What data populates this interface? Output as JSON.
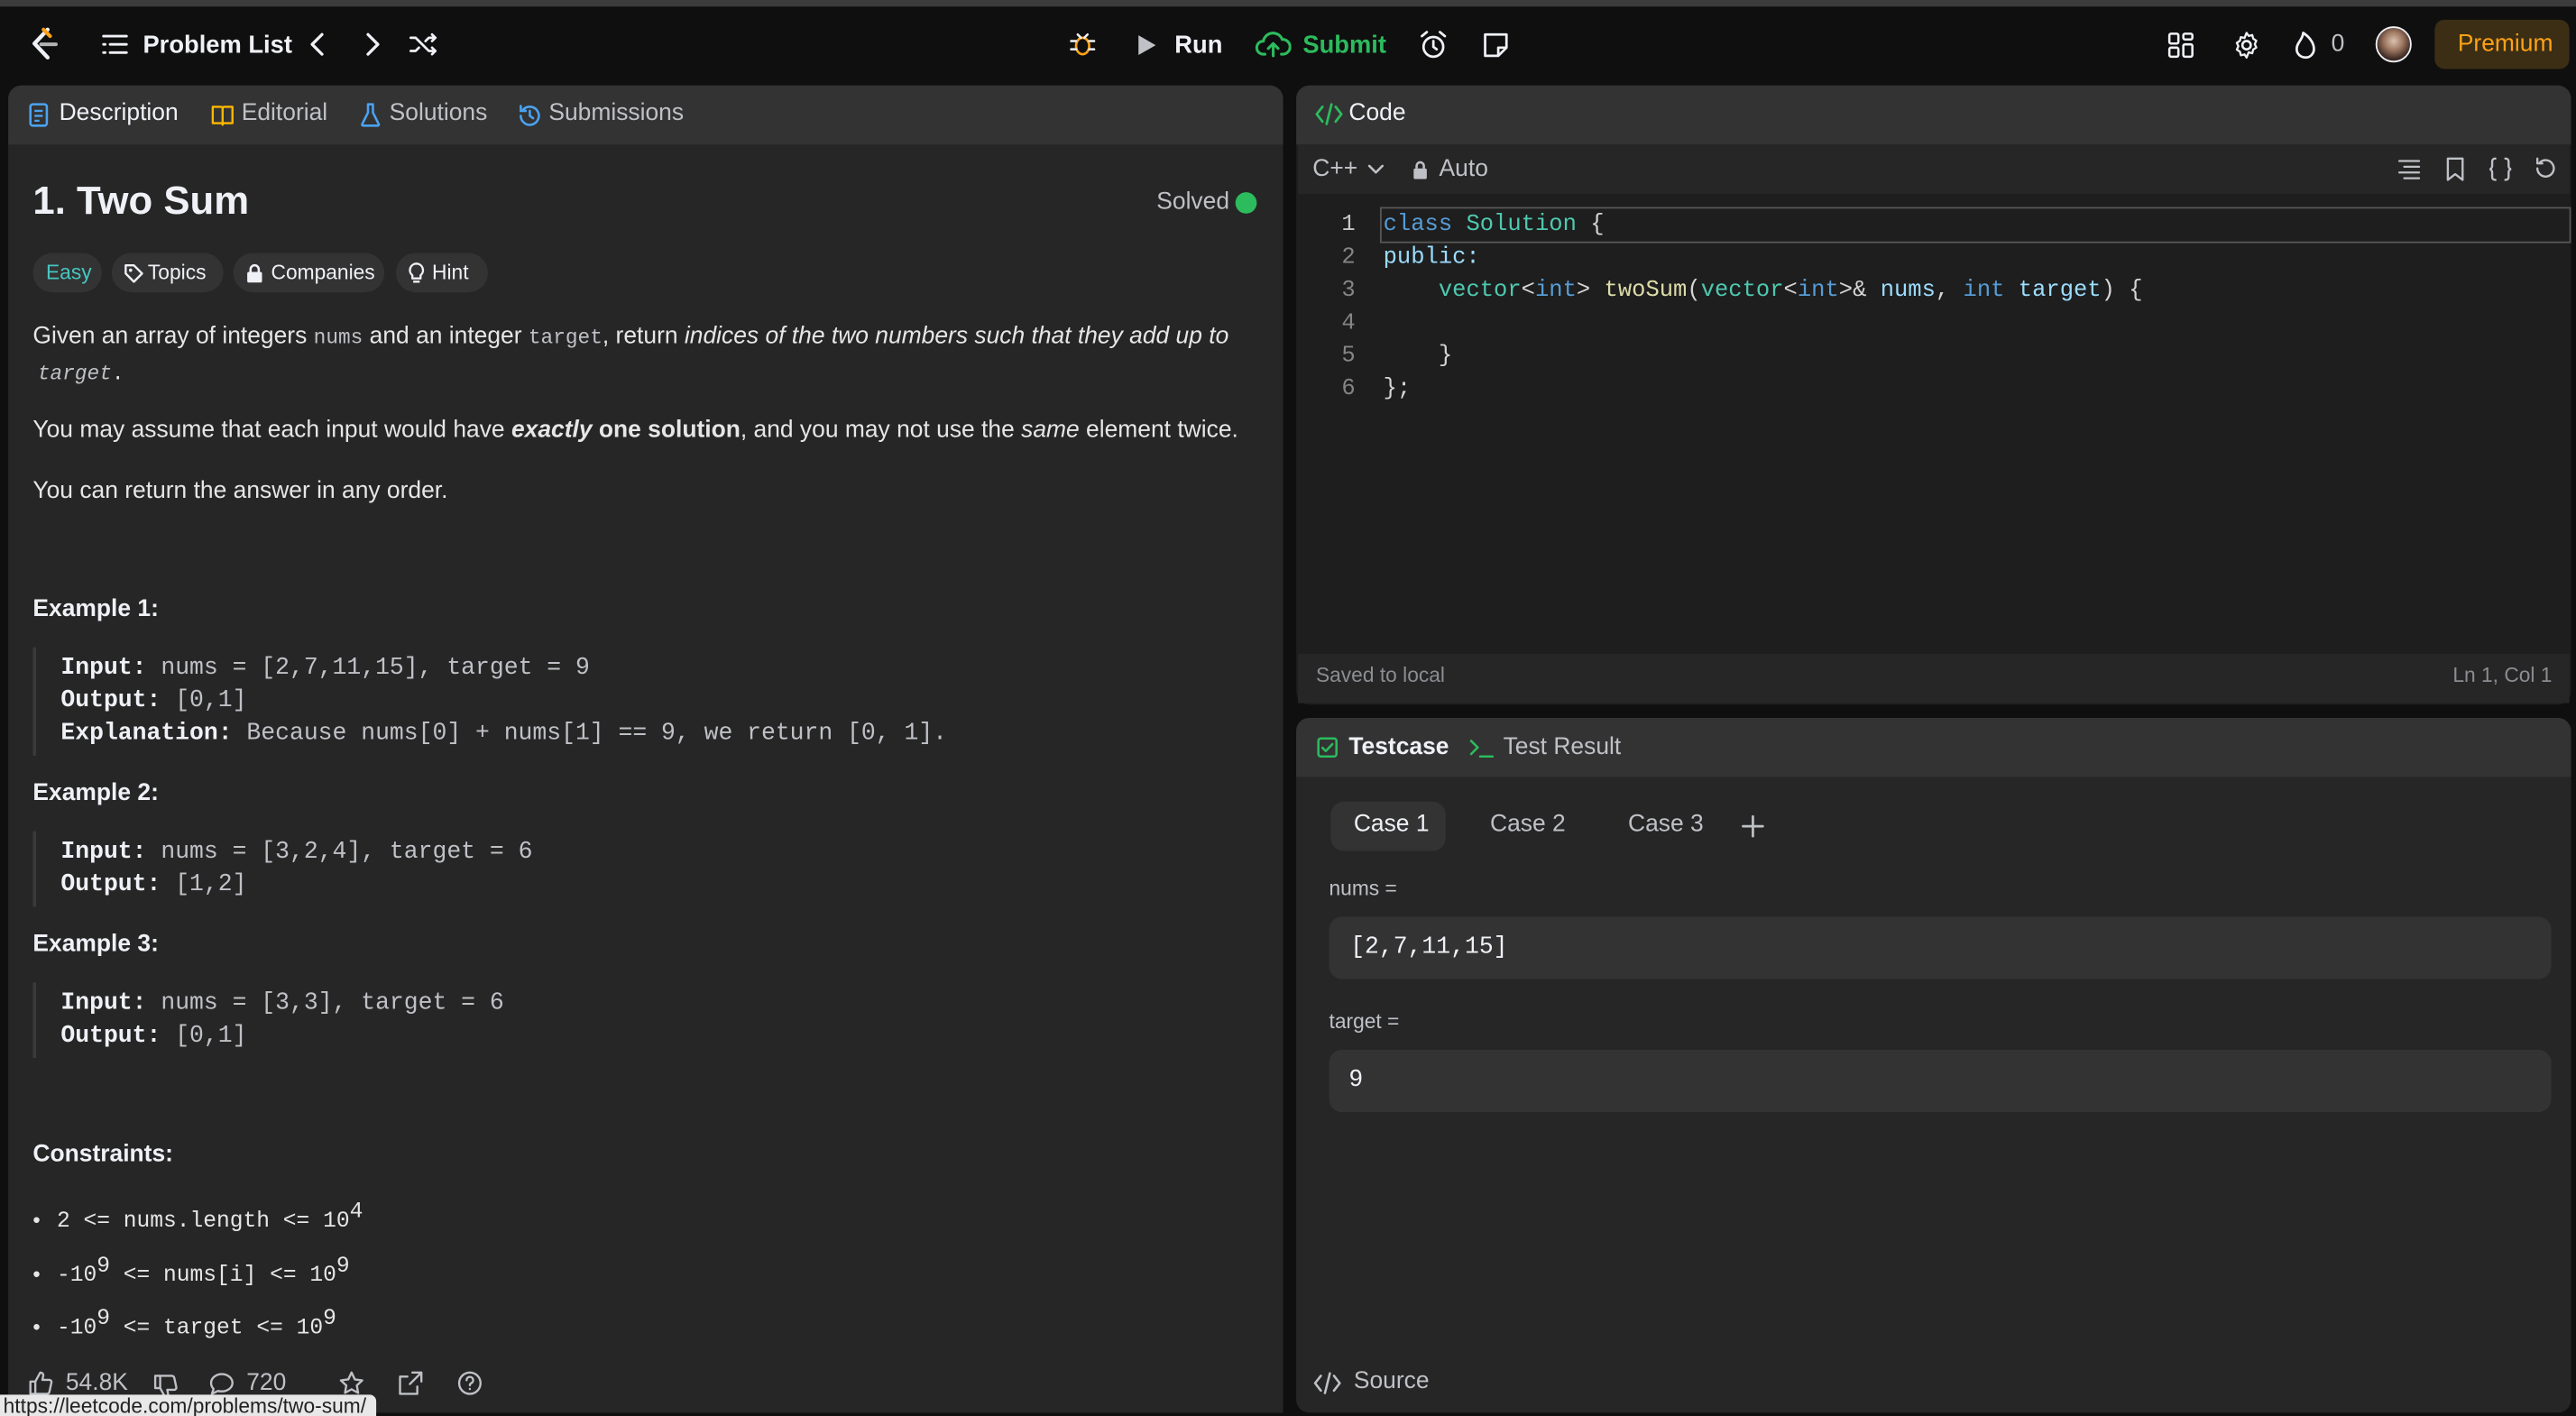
{
  "topbar": {
    "problem_list": "Problem List",
    "run": "Run",
    "submit": "Submit",
    "streak": "0",
    "premium": "Premium"
  },
  "left_tabs": [
    "Description",
    "Editorial",
    "Solutions",
    "Submissions"
  ],
  "problem": {
    "title": "1. Two Sum",
    "solved": "Solved",
    "difficulty": "Easy",
    "topics": "Topics",
    "companies": "Companies",
    "hint": "Hint",
    "p1_a": "Given an array of integers ",
    "p1_nums": "nums",
    "p1_b": " and an integer ",
    "p1_target": "target",
    "p1_c": ", return ",
    "p1_em": "indices of the two numbers such that they add up to",
    "p1_target2": "target",
    "p1_d": ".",
    "p2_a": "You may assume that each input would have ",
    "p2_exactly": "exactly",
    "p2_one": " one solution",
    "p2_b": ", and you may not use the ",
    "p2_same": "same",
    "p2_c": " element twice.",
    "p3": "You can return the answer in any order."
  },
  "examples": [
    {
      "title": "Example 1:",
      "input_label": "Input:",
      "input": " nums = [2,7,11,15], target = 9",
      "output_label": "Output:",
      "output": " [0,1]",
      "expl_label": "Explanation:",
      "expl": " Because nums[0] + nums[1] == 9, we return [0, 1]."
    },
    {
      "title": "Example 2:",
      "input_label": "Input:",
      "input": " nums = [3,2,4], target = 6",
      "output_label": "Output:",
      "output": " [1,2]"
    },
    {
      "title": "Example 3:",
      "input_label": "Input:",
      "input": " nums = [3,3], target = 6",
      "output_label": "Output:",
      "output": " [0,1]"
    }
  ],
  "constraints": {
    "title": "Constraints:",
    "c1_code": "2 <= nums.length <= 10",
    "c1_sup": "4",
    "c2_a": "-10",
    "c2_sup1": "9",
    "c2_b": " <= nums[i] <= 10",
    "c2_sup2": "9",
    "c3_a": "-10",
    "c3_sup1": "9",
    "c3_b": " <= target <= 10",
    "c3_sup2": "9"
  },
  "footer": {
    "likes": "54.8K",
    "comments": "720",
    "url": "https://leetcode.com/problems/two-sum/"
  },
  "code": {
    "title": "Code",
    "language": "C++",
    "auto": "Auto",
    "line_numbers": [
      "1",
      "2",
      "3",
      "4",
      "5",
      "6"
    ],
    "l1_kw": "class",
    "l1_name": " Solution",
    "l1_rest": " {",
    "l2": "public:",
    "l3_indent": "    ",
    "l3_type": "vector",
    "l3_a": "<",
    "l3_int": "int",
    "l3_b": "> ",
    "l3_fn": "twoSum",
    "l3_c": "(",
    "l3_type2": "vector",
    "l3_d": "<",
    "l3_int2": "int",
    "l3_e": ">& ",
    "l3_nums": "nums",
    "l3_f": ", ",
    "l3_int3": "int",
    "l3_g": " ",
    "l3_target": "target",
    "l3_h": ") {",
    "l5": "    }",
    "l6": "};",
    "saved": "Saved to local",
    "cursor": "Ln 1, Col 1"
  },
  "testcase": {
    "tab": "Testcase",
    "result_tab": "Test Result",
    "cases": [
      "Case 1",
      "Case 2",
      "Case 3"
    ],
    "nums_label": "nums =",
    "nums_value": "[2,7,11,15]",
    "target_label": "target =",
    "target_value": "9",
    "source": "Source"
  },
  "colors": {
    "background": "#0f0f0f",
    "panel": "#262626",
    "easy": "#46c6c2",
    "submit": "#2cbb5d",
    "premium": "#ffa116",
    "solved": "#2cbb5d"
  }
}
